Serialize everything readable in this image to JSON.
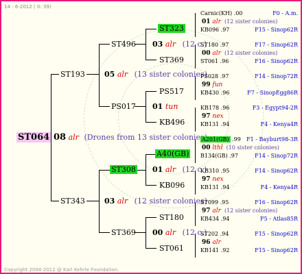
{
  "header": {
    "date": "14 -  6-2012 (  0: 39)"
  },
  "footer": {
    "copyright": "Copyright 2004-2012 @ Karl Kehrle Foundation."
  },
  "root": {
    "id": "ST064",
    "gen": "08",
    "tag": "alr",
    "note": "(Drones from 13 sister colonies)"
  },
  "l1": {
    "top": {
      "id": "ST193",
      "gen": "05",
      "tag": "alr",
      "note": "(13 sister colonies)"
    },
    "bottom": {
      "id": "ST343",
      "gen": "03",
      "tag": "alr",
      "note": "(12 sister colonies)"
    }
  },
  "l2": {
    "a": {
      "id": "ST496"
    },
    "b": {
      "id": "PS017"
    },
    "c": {
      "id": "ST308"
    },
    "d": {
      "id": "ST369"
    }
  },
  "l3": {
    "a": {
      "up": "ST323",
      "gen": "03",
      "tag": "alr",
      "note": "(12 c.)",
      "down": "ST369"
    },
    "b": {
      "up": "PS517",
      "gen": "01",
      "tag": "tun",
      "down": "KB496"
    },
    "c": {
      "up": "A40(GB)",
      "gen": "01",
      "tag": "alr",
      "note": "(12 c.)",
      "down": "KB096"
    },
    "d": {
      "up": "ST180",
      "gen": "00",
      "tag": "alr",
      "note": "(12 c.)",
      "down": "ST061"
    }
  },
  "l4": [
    {
      "top": "Carnic(KH)",
      "top_val": ".00",
      "top_code": "F0 - A.m.",
      "gen": "01",
      "tag": "alr",
      "note": "(12 sister colonies)",
      "bot": "KB096",
      "bot_val": ".97",
      "bot_code": "F15 - Sinop62R"
    },
    {
      "top": "ST180",
      "top_val": ".97",
      "top_code": "F17 - Sinop62R",
      "gen": "00",
      "tag": "alr",
      "note": "(12 sister colonies)",
      "bot": "ST061",
      "bot_val": ".96",
      "bot_code": "F16 - Sinop62R"
    },
    {
      "top": "PS028",
      "top_val": ".97",
      "top_code": "F14 - Sinop72R",
      "gen": "99",
      "tag": "fun",
      "note": "",
      "bot": "KB430",
      "bot_val": ".96",
      "bot_code": "F7 - SinopEgg86R"
    },
    {
      "top": "KB178",
      "top_val": ".96",
      "top_code": "F3 - Egypt94-2R",
      "gen": "97",
      "tag": "nex",
      "note": "",
      "bot": "KB131",
      "bot_val": ".94",
      "bot_code": "F4 - Kenya4R"
    },
    {
      "top": "A201(GB)",
      "top_val": ".99",
      "top_code": "F1 - Bayburt98-3R",
      "gen": "00",
      "tag": "lthl",
      "note": "(10 sister colonies)",
      "bot": "B134(GB)",
      "bot_val": ".97",
      "bot_code": "F14 - Sinop72R"
    },
    {
      "top": "KB310",
      "top_val": ".95",
      "top_code": "F14 - Sinop62R",
      "gen": "97",
      "tag": "nex",
      "note": "",
      "bot": "KB131",
      "bot_val": ".94",
      "bot_code": "F4 - Kenya4R"
    },
    {
      "top": "ST099",
      "top_val": ".95",
      "top_code": "F16 - Sinop62R",
      "gen": "97",
      "tag": "alr",
      "note": "(12 sister colonies)",
      "bot": "KB434",
      "bot_val": ".94",
      "bot_code": "F5 - Atlas85R"
    },
    {
      "top": "ST202",
      "top_val": ".94",
      "top_code": "F15 - Sinop62R",
      "gen": "96",
      "tag": "alr",
      "note": "",
      "bot": "KB141",
      "bot_val": ".92",
      "bot_code": "F15 - Sinop62R"
    }
  ]
}
